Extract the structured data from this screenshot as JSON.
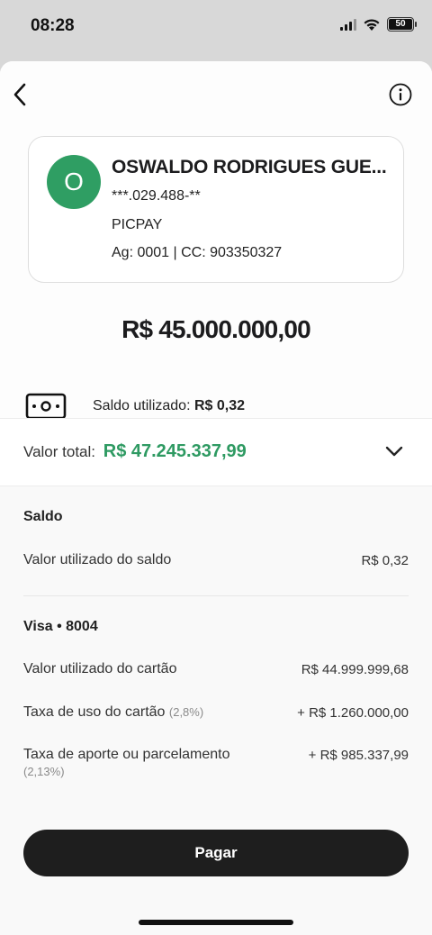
{
  "status_bar": {
    "time": "08:28",
    "battery": "50",
    "icons": [
      "cellular-signal-icon",
      "wifi-icon",
      "battery-icon"
    ]
  },
  "header": {
    "back_icon": "chevron-left-icon",
    "info_icon": "info-circle-icon"
  },
  "recipient": {
    "initial": "O",
    "name": "OSWALDO RODRIGUES GUE...",
    "document": "***.029.488-**",
    "bank": "PICPAY",
    "account": "Ag: 0001 | CC: 903350327",
    "avatar_color": "#2f9e63"
  },
  "amount": "R$ 45.000.000,00",
  "balance_used": {
    "label": "Saldo utilizado:",
    "value": "R$ 0,32",
    "icon": "money-bill-icon"
  },
  "total": {
    "label": "Valor total:",
    "value": "R$ 47.245.337,99",
    "color": "#2e9a62",
    "expand_icon": "chevron-down-icon"
  },
  "breakdown": {
    "saldo": {
      "title": "Saldo",
      "rows": [
        {
          "label": "Valor utilizado do saldo",
          "value": "R$ 0,32"
        }
      ]
    },
    "card": {
      "title": "Visa • 8004",
      "rows": [
        {
          "label": "Valor utilizado do cartão",
          "note": "",
          "value": "R$ 44.999.999,68"
        },
        {
          "label": "Taxa de uso do cartão",
          "note": "(2,8%)",
          "value": "+ R$ 1.260.000,00"
        },
        {
          "label": "Taxa de aporte ou parcelamento",
          "note": "(2,13%)",
          "value": "+ R$ 985.337,99"
        }
      ]
    }
  },
  "pay_button": "Pagar"
}
